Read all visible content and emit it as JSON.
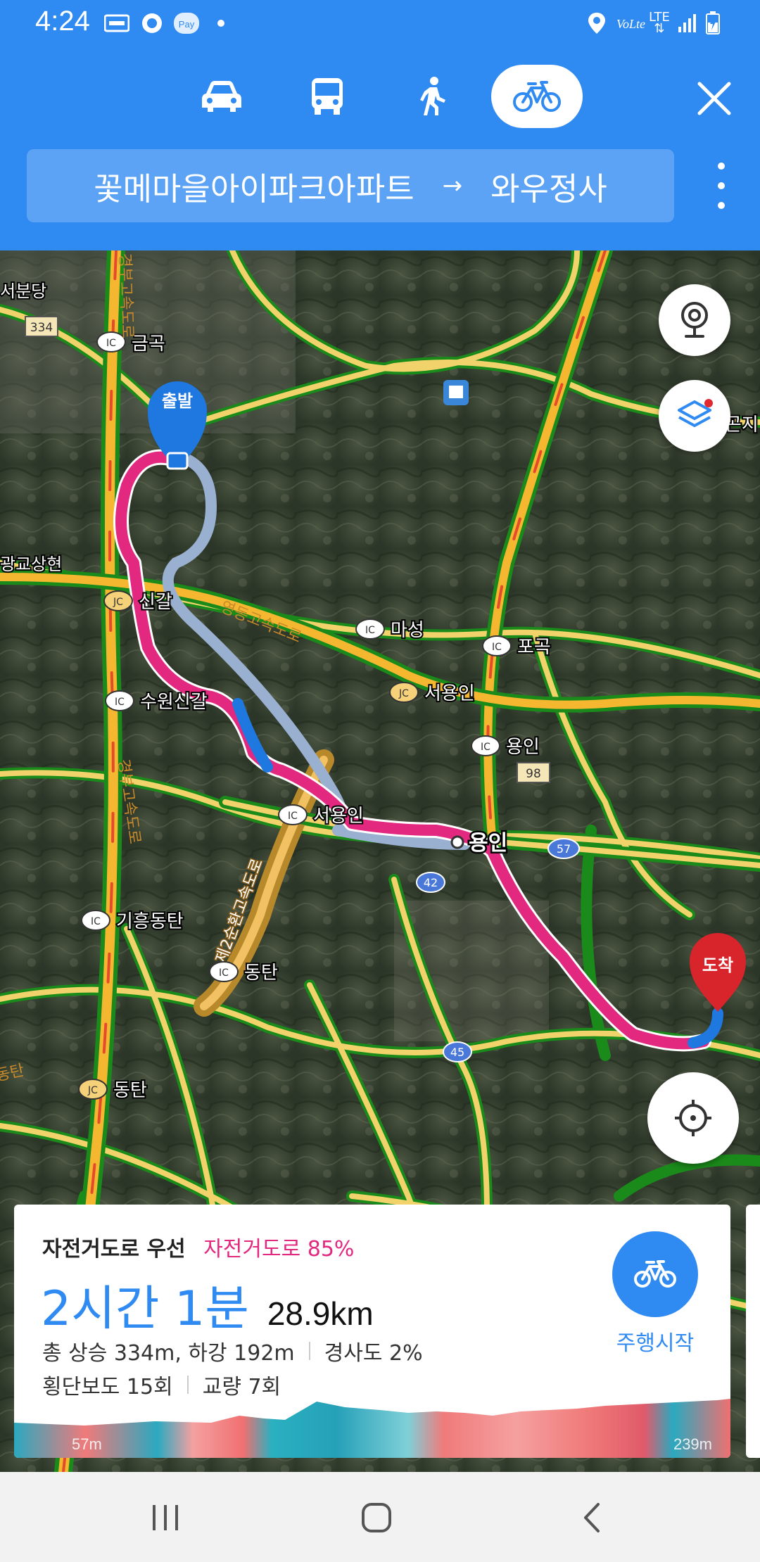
{
  "status_bar": {
    "time": "4:24",
    "lte": "LTE"
  },
  "transport_modes": [
    {
      "name": "car",
      "icon": "car-icon"
    },
    {
      "name": "bus",
      "icon": "bus-icon"
    },
    {
      "name": "walk",
      "icon": "walk-icon"
    },
    {
      "name": "bike",
      "icon": "bike-icon",
      "active": true
    }
  ],
  "route": {
    "origin": "꽃메마을아이파크아파트",
    "arrow": "→",
    "destination": "와우정사"
  },
  "map": {
    "start_marker": "출발",
    "end_marker": "도착",
    "labels": {
      "seobundang": "서분당",
      "geumgok": "금곡",
      "gwanggyo": "광교상현",
      "singal": "신갈",
      "suwon_singal": "수원신갈",
      "yeongdong": "영동고속도로",
      "maseong": "마성",
      "pogok": "포곡",
      "seoyongin_jc": "서용인",
      "yongin_ic": "용인",
      "seoyongin_ic": "서용인",
      "yongin_city": "용인",
      "giheung": "기흥동탄",
      "dongtan_ic": "동탄",
      "dongtan_jc": "동탄",
      "dongtan_left": "동탄",
      "gyeongbu": "경부고속도로",
      "second_ring": "제2순환고속도로",
      "gonji": "곤지",
      "route_334": "334",
      "route_98": "98",
      "route_57": "57",
      "route_42": "42",
      "route_45": "45",
      "ic": "IC",
      "jc": "JC"
    }
  },
  "summary": {
    "preference": "자전거도로 우선",
    "bike_road_pct": "자전거도로 85%",
    "duration": "2시간 1분",
    "distance": "28.9km",
    "climb": "총 상승 334m, 하강 192m",
    "slope": "경사도 2%",
    "crosswalks": "횡단보도 15회",
    "bridges": "교량 7회",
    "start_label": "주행시작",
    "elev_min": "57m",
    "elev_max": "239m"
  },
  "colors": {
    "accent": "#2f8af2",
    "route_pink": "#e2287f",
    "alt_route": "#9ab0d0"
  }
}
